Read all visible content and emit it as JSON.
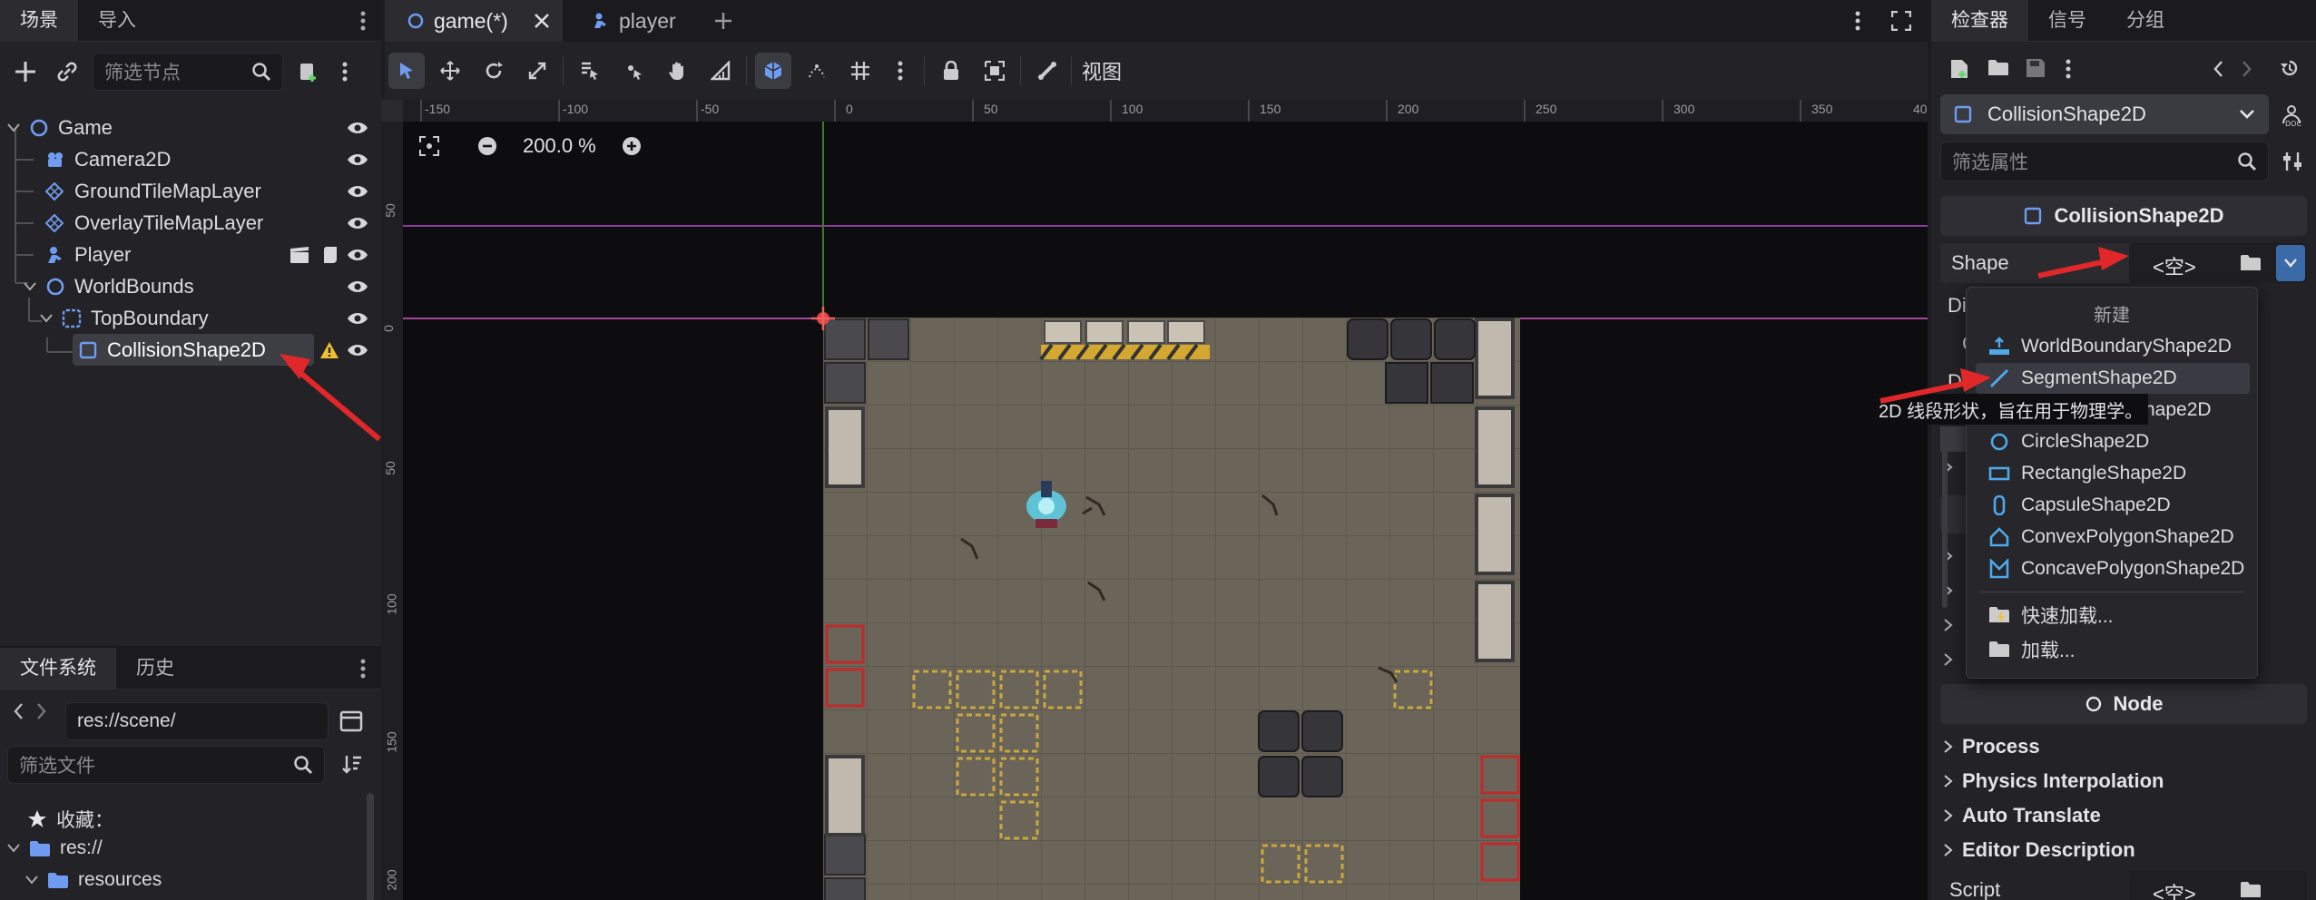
{
  "left_dock": {
    "tabs": [
      "场景",
      "导入"
    ],
    "filter_placeholder": "筛选节点",
    "tree": [
      {
        "label": "Game",
        "icon": "node2d-icon"
      },
      {
        "label": "Camera2D",
        "icon": "camera-icon"
      },
      {
        "label": "GroundTileMapLayer",
        "icon": "tilemap-icon"
      },
      {
        "label": "OverlayTileMapLayer",
        "icon": "tilemap-icon"
      },
      {
        "label": "Player",
        "icon": "character-icon"
      },
      {
        "label": "WorldBounds",
        "icon": "node2d-icon"
      },
      {
        "label": "TopBoundary",
        "icon": "staticbody-icon"
      },
      {
        "label": "CollisionShape2D",
        "icon": "collision-shape-icon"
      }
    ]
  },
  "filesystem": {
    "tabs": [
      "文件系统",
      "历史"
    ],
    "path": "res://scene/",
    "filter_placeholder": "筛选文件",
    "items": [
      "收藏：",
      "res://",
      "resources"
    ]
  },
  "scene_tabs": [
    {
      "label": "game(*)"
    },
    {
      "label": "player"
    }
  ],
  "toolbar": {
    "view_label": "视图"
  },
  "viewport": {
    "zoom": "200.0 %",
    "ruler_h": [
      "-150",
      "-100",
      "-50",
      "0",
      "50",
      "100",
      "150",
      "200",
      "250",
      "300",
      "350",
      "40"
    ],
    "ruler_v": [
      "50",
      "0",
      "50",
      "100",
      "150",
      "200"
    ]
  },
  "inspector": {
    "tabs": [
      "检查器",
      "信号",
      "分组"
    ],
    "node_type": "CollisionShape2D",
    "filter_placeholder": "筛选属性",
    "section_title": "CollisionShape2D",
    "shape_label": "Shape",
    "shape_value": "<空>",
    "partial_labels": [
      "Di",
      "C",
      "D"
    ],
    "node_section": "Node",
    "collapsibles": [
      "Process",
      "Physics Interpolation",
      "Auto Translate",
      "Editor Description"
    ],
    "script_label": "Script",
    "script_value": "<空>"
  },
  "popup": {
    "header": "新建",
    "items": [
      {
        "label": "WorldBoundaryShape2D",
        "icon": "world-boundary-icon"
      },
      {
        "label": "SegmentShape2D",
        "icon": "segment-icon"
      },
      {
        "label": "hape2D",
        "icon": "none"
      },
      {
        "label": "CircleShape2D",
        "icon": "circle-icon"
      },
      {
        "label": "RectangleShape2D",
        "icon": "rectangle-icon"
      },
      {
        "label": "CapsuleShape2D",
        "icon": "capsule-icon"
      },
      {
        "label": "ConvexPolygonShape2D",
        "icon": "convex-polygon-icon"
      },
      {
        "label": "ConcavePolygonShape2D",
        "icon": "concave-polygon-icon"
      }
    ],
    "quick_load": "快速加载...",
    "load": "加载..."
  },
  "tooltip": "2D 线段形状，旨在用于物理学。",
  "colors": {
    "accent": "#4a8ff0",
    "arrow": "#e0282a",
    "warning": "#f0c030"
  }
}
